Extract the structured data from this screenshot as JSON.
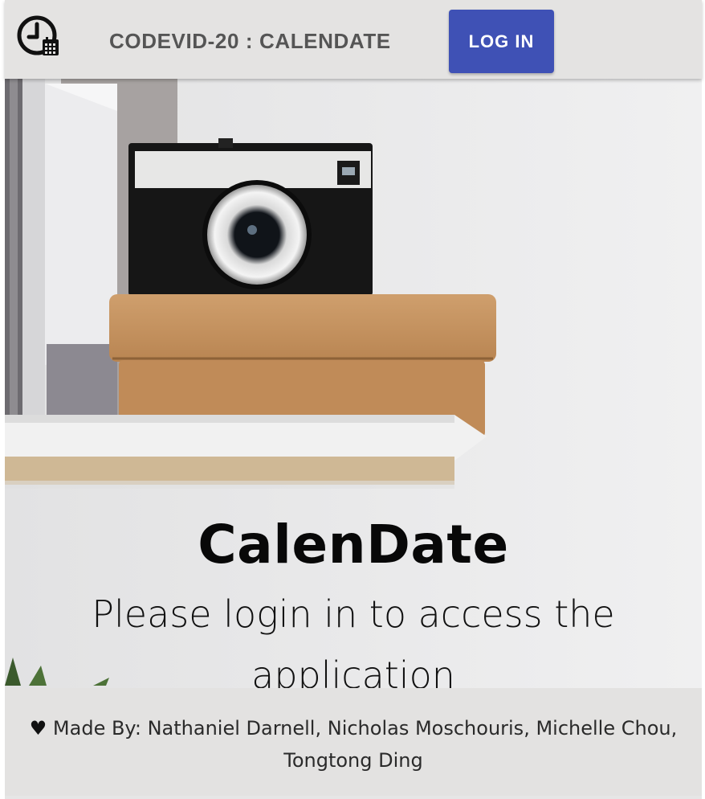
{
  "header": {
    "logo_icon": "clock-calendar-icon",
    "title": "CODEVID-20 : CALENDATE",
    "login_label": "LOG IN",
    "accent_color": "#3f51b5"
  },
  "hero": {
    "image": "camera-on-cork-box-on-shelf",
    "title": "CalenDate",
    "subtitle": "Please login in to access the application"
  },
  "footer": {
    "heart_icon": "♥",
    "credits": "Made By: Nathaniel Darnell, Nicholas Moschouris, Michelle Chou, Tongtong Ding"
  }
}
